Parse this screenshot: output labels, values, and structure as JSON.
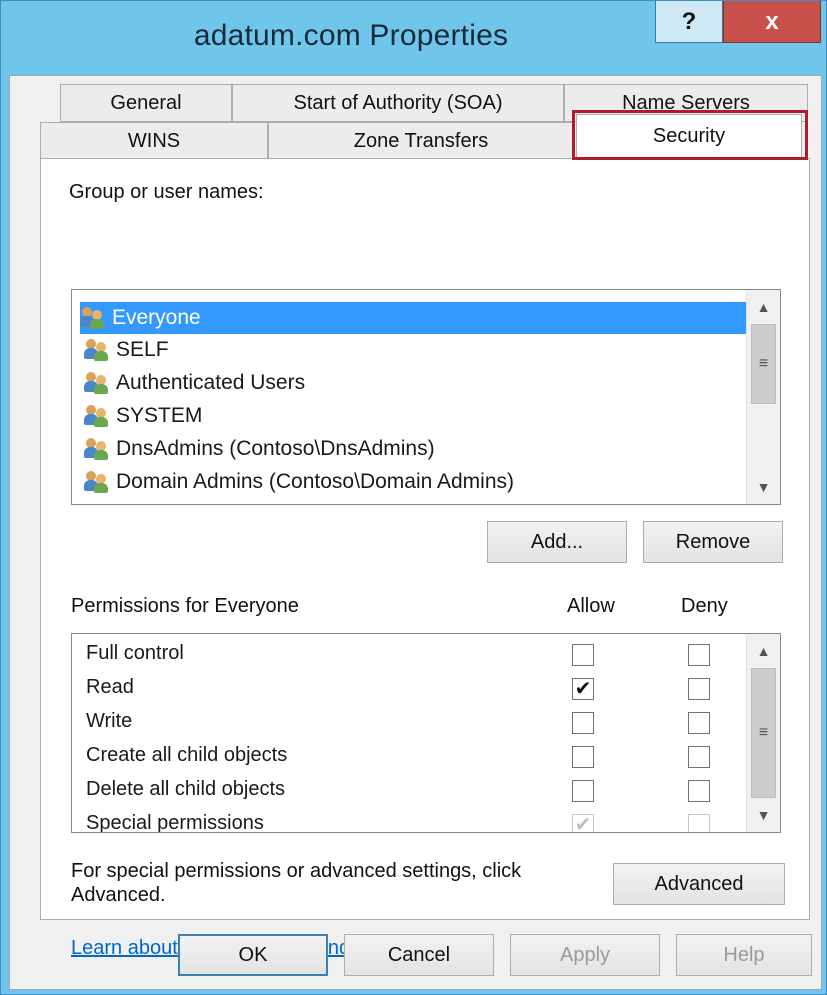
{
  "window": {
    "title": "adatum.com Properties",
    "help_label": "?",
    "close_label": "x"
  },
  "tabs": {
    "row1": [
      "General",
      "Start of Authority (SOA)",
      "Name Servers"
    ],
    "row2": [
      "WINS",
      "Zone Transfers",
      "Security"
    ],
    "active": "Security"
  },
  "security": {
    "group_label": "Group or user names:",
    "users": [
      "Everyone",
      "SELF",
      "Authenticated Users",
      "SYSTEM",
      "DnsAdmins (Contoso\\DnsAdmins)",
      "Domain Admins (Contoso\\Domain Admins)"
    ],
    "selected_user": "Everyone",
    "add_label": "Add...",
    "remove_label": "Remove",
    "permissions_label": "Permissions for Everyone",
    "allow_label": "Allow",
    "deny_label": "Deny",
    "permissions": [
      {
        "name": "Full control",
        "allow": false,
        "deny": false
      },
      {
        "name": "Read",
        "allow": true,
        "deny": false
      },
      {
        "name": "Write",
        "allow": false,
        "deny": false
      },
      {
        "name": "Create all child objects",
        "allow": false,
        "deny": false
      },
      {
        "name": "Delete all child objects",
        "allow": false,
        "deny": false
      },
      {
        "name": "Special permissions",
        "allow": true,
        "deny": false,
        "inherited": true
      }
    ],
    "advanced_text": "For special permissions or advanced settings, click Advanced.",
    "advanced_label": "Advanced",
    "learn_link": "Learn about access control and permissions"
  },
  "footer": {
    "ok": "OK",
    "cancel": "Cancel",
    "apply": "Apply",
    "help": "Help"
  },
  "colors": {
    "title_bar": "#6fc5ea",
    "selection": "#3399ff",
    "close": "#c7514a",
    "highlight": "#b01d2a",
    "link": "#0066cc"
  },
  "icons": {
    "user_group": "group-users-icon",
    "check": "checkmark-icon"
  }
}
